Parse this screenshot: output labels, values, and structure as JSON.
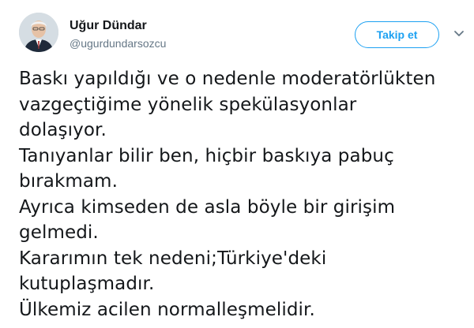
{
  "author": {
    "display_name": "Uğur Dündar",
    "username": "@ugurdundarsozcu"
  },
  "actions": {
    "follow_label": "Takip et",
    "follow_color": "#1da1f2"
  },
  "icons": {
    "avatar": "profile-photo",
    "menu": "chevron-down-icon"
  },
  "tweet": {
    "lines": [
      "Baskı yapıldığı ve o nedenle moderatörlükten",
      "vazgeçtiğime yönelik spekülasyonlar",
      "dolaşıyor.",
      "Tanıyanlar bilir ben, hiçbir baskıya pabuç",
      "bırakmam.",
      "Ayrıca kimseden de asla böyle bir girişim",
      "gelmedi.",
      "Kararımın tek nedeni;Türkiye'deki",
      "kutuplaşmadır.",
      "Ülkemiz acilen normalleşmelidir."
    ]
  }
}
